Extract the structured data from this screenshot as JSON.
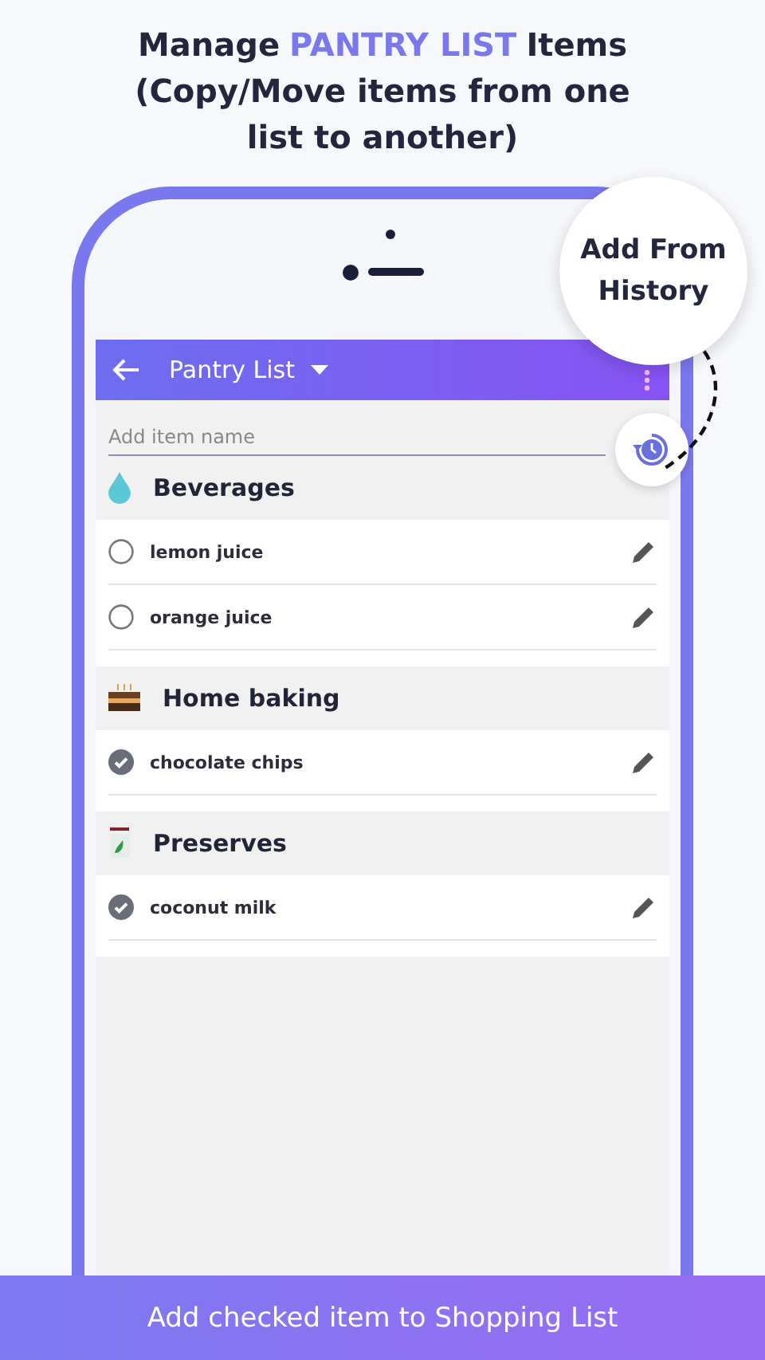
{
  "headline": {
    "before": "Manage",
    "highlight": "PANTRY LIST",
    "after": "Items (Copy/Move items from one list to another)"
  },
  "callout": "Add From History",
  "app_bar": {
    "title": "Pantry List"
  },
  "add_field": {
    "placeholder": "Add item name"
  },
  "categories": [
    {
      "name": "Beverages",
      "items": [
        {
          "name": "lemon juice",
          "checked": false
        },
        {
          "name": "orange juice",
          "checked": false
        }
      ]
    },
    {
      "name": "Home baking",
      "items": [
        {
          "name": "chocolate chips",
          "checked": true
        }
      ]
    },
    {
      "name": "Preserves",
      "items": [
        {
          "name": "coconut milk",
          "checked": true
        }
      ]
    }
  ],
  "banner": "Add checked item to Shopping List"
}
